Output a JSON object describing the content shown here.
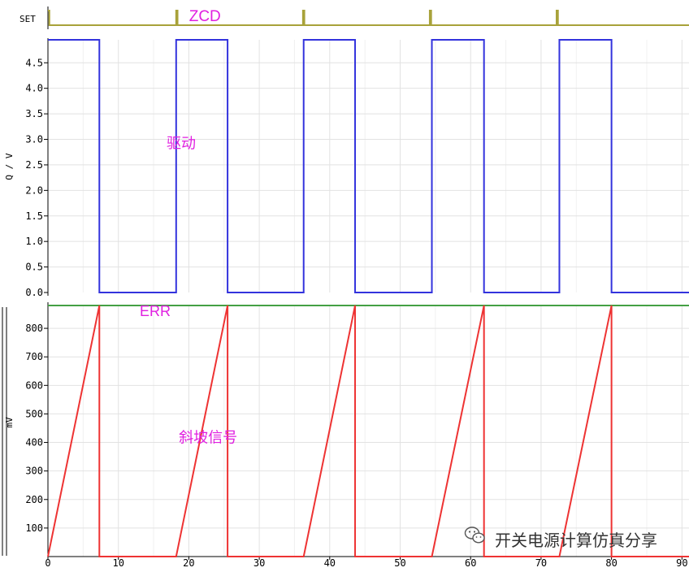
{
  "colors": {
    "set": "#a8a23a",
    "q": "#3333dd",
    "err": "#44a044",
    "ramp": "#ee3333",
    "annotation": "#e020e0",
    "grid": "#e2e2e2",
    "axis": "#000000",
    "watermark": "#333333"
  },
  "watermark": {
    "icon": "wechat-icon",
    "text": "开关电源计算仿真分享"
  },
  "chart_data": [
    {
      "type": "line",
      "title": "",
      "ylabel": "SET",
      "x_unit_labels": "shared time axis (see bottom panel)",
      "series": [
        {
          "name": "SET",
          "x": [
            0,
            0.2,
            0.2,
            18.2,
            18.2,
            18.4,
            18.4,
            36.2,
            36.2,
            36.4,
            36.4,
            54.2,
            54.2,
            54.4,
            54.4,
            72.2,
            72.2,
            72.4,
            72.4,
            91
          ],
          "y": [
            1,
            1,
            0,
            0,
            1,
            1,
            0,
            0,
            1,
            1,
            0,
            0,
            1,
            1,
            0,
            0,
            1,
            1,
            0,
            0
          ]
        }
      ],
      "annotations": [
        {
          "text": "ZCD",
          "x": 22,
          "y": 1
        }
      ]
    },
    {
      "type": "line",
      "title": "",
      "ylabel": "Q / V",
      "ylim": [
        0,
        4.95
      ],
      "yticks": [
        "0.0",
        "0.5",
        "1.0",
        "1.5",
        "2.0",
        "2.5",
        "3.0",
        "3.5",
        "4.0",
        "4.5"
      ],
      "grid": true,
      "series": [
        {
          "name": "Q",
          "x": [
            0,
            7.3,
            7.3,
            18.2,
            18.2,
            25.5,
            25.5,
            36.3,
            36.3,
            43.6,
            43.6,
            54.5,
            54.5,
            61.9,
            61.9,
            72.6,
            72.6,
            80.0,
            80.0,
            91
          ],
          "y": [
            4.95,
            4.95,
            0,
            0,
            4.95,
            4.95,
            0,
            0,
            4.95,
            4.95,
            0,
            0,
            4.95,
            4.95,
            0,
            0,
            4.95,
            4.95,
            0,
            0
          ]
        }
      ],
      "annotations": [
        {
          "text": "驱动",
          "x": 18.8,
          "y": 2.95
        }
      ]
    },
    {
      "type": "line",
      "title": "",
      "ylabel": "mV",
      "ylim": [
        0,
        880
      ],
      "xlim": [
        0,
        91
      ],
      "yticks": [
        "100",
        "200",
        "300",
        "400",
        "500",
        "600",
        "700",
        "800"
      ],
      "xticks": [
        "0",
        "10",
        "20",
        "30",
        "40",
        "50",
        "60",
        "70",
        "80",
        "90"
      ],
      "grid": true,
      "series": [
        {
          "name": "ERR",
          "x": [
            0,
            91
          ],
          "y": [
            880,
            880
          ]
        },
        {
          "name": "斜坡信号",
          "x": [
            0,
            7.3,
            7.3,
            18.2,
            25.5,
            25.5,
            36.3,
            43.6,
            43.6,
            54.5,
            61.9,
            61.9,
            72.6,
            80.0,
            80.0,
            91
          ],
          "y": [
            0,
            880,
            0,
            0,
            880,
            0,
            0,
            880,
            0,
            0,
            880,
            0,
            0,
            880,
            0,
            0
          ]
        }
      ],
      "annotations": [
        {
          "text": "ERR",
          "x": 15,
          "y": 880
        },
        {
          "text": "斜坡信号",
          "x": 23.2,
          "y": 420
        }
      ]
    }
  ]
}
